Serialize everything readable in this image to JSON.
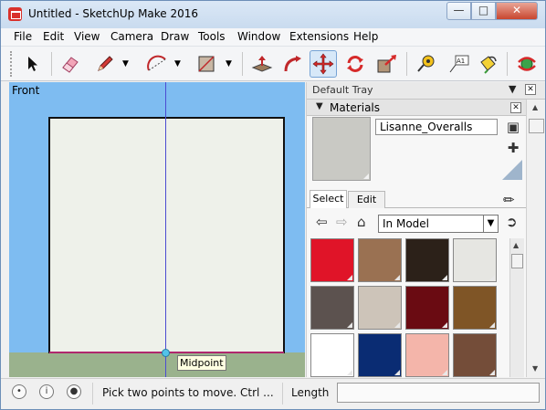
{
  "window": {
    "title": "Untitled - SketchUp Make 2016"
  },
  "menubar": [
    "File",
    "Edit",
    "View",
    "Camera",
    "Draw",
    "Tools",
    "Window",
    "Extensions",
    "Help"
  ],
  "toolbar": {
    "tools": [
      "select-icon",
      "eraser-icon",
      "pencil-icon",
      "arc-icon",
      "rectangle-icon",
      "push-pull-icon",
      "follow-me-icon",
      "move-icon",
      "rotate-icon",
      "scale-icon",
      "tape-measure-icon",
      "text-icon",
      "paint-bucket-icon",
      "orbit-icon"
    ],
    "active_tool": "move-icon",
    "text_tool_glyph": "A1"
  },
  "viewport": {
    "scene_label": "Front",
    "tooltip": "Midpoint",
    "colors": {
      "sky": "#7ebcf1",
      "ground": "#9ab28d",
      "face": "#eef1ea",
      "blue_axis": "#4c4cd2",
      "red_axis": "#b0286d"
    }
  },
  "tray": {
    "title": "Default Tray",
    "panel_title": "Materials",
    "material_name": "Lisanne_Overalls",
    "preview_color": "#c9c9c4",
    "tabs": [
      "Select",
      "Edit"
    ],
    "active_tab": "Select",
    "collection": "In Model",
    "swatches": [
      "#e01428",
      "#9a7152",
      "#2c2119",
      "#e6e6e2",
      "#5c524f",
      "#cdc4b9",
      "#6a0b12",
      "#7f5526",
      "#ffffff",
      "#0a2c73",
      "#f4b5aa",
      "#744d39"
    ]
  },
  "statusbar": {
    "message": "Pick two points to move.  Ctrl ...",
    "measurements_label": "Length",
    "measurements_value": ""
  }
}
